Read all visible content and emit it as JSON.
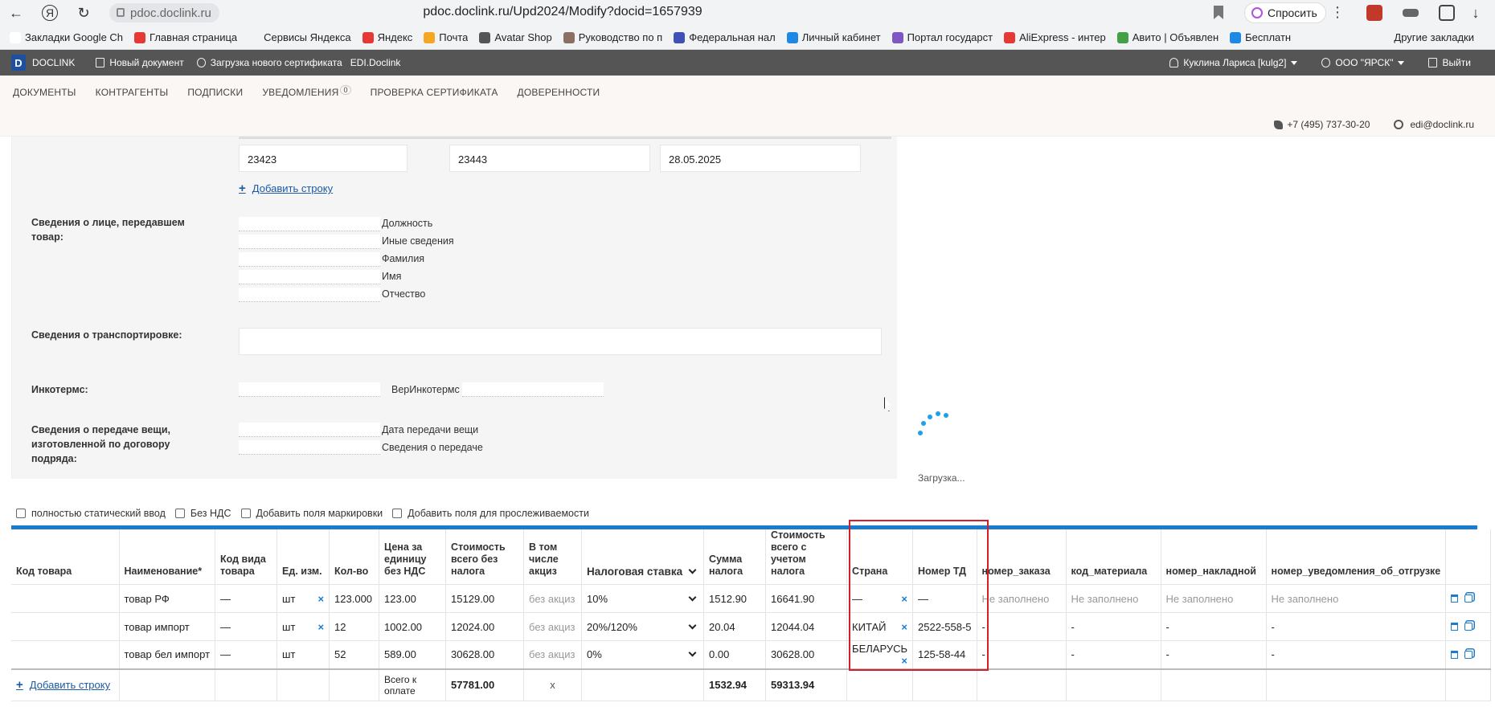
{
  "browser": {
    "host": "pdoc.doclink.ru",
    "url": "pdoc.doclink.ru/Upd2024/Modify?docid=1657939",
    "ask_label": "Спросить",
    "bookmarks": [
      {
        "label": "Закладки Google Ch",
        "color": "#ffffff"
      },
      {
        "label": "Главная страница",
        "color": "#e53935"
      },
      {
        "label": "Сервисы Яндекса",
        "color": "#f1f3f4"
      },
      {
        "label": "Яндекс",
        "color": "#e53935"
      },
      {
        "label": "Почта",
        "color": "#f5a623"
      },
      {
        "label": "Avatar Shop",
        "color": "#555555"
      },
      {
        "label": "Руководство по п",
        "color": "#8d6e63"
      },
      {
        "label": "Федеральная нал",
        "color": "#3f51b5"
      },
      {
        "label": "Личный кабинет",
        "color": "#1e88e5"
      },
      {
        "label": "Портал государст",
        "color": "#7e57c2"
      },
      {
        "label": "AliExpress - интер",
        "color": "#e53935"
      },
      {
        "label": "Авито | Объявлен",
        "color": "#43a047"
      },
      {
        "label": "Бесплатн",
        "color": "#1e88e5"
      }
    ],
    "other_bookmarks": "Другие закладки"
  },
  "app": {
    "logo": "D",
    "brand": "DOCLINK",
    "new_doc": "Новый документ",
    "upload_cert": "Загрузка нового сертификата",
    "edi": "EDI.Doclink",
    "user": "Куклина Лариса [kulg2]",
    "org": "ООО \"ЯРСК\"",
    "logout": "Выйти"
  },
  "nav": {
    "documents": "ДОКУМЕНТЫ",
    "contractors": "КОНТРАГЕНТЫ",
    "signatures": "ПОДПИСКИ",
    "notifications": "УВЕДОМЛЕНИЯ",
    "notifications_count": "0",
    "cert_check": "ПРОВЕРКА СЕРТИФИКАТА",
    "powers": "ДОВЕРЕННОСТИ",
    "phone": "+7 (495) 737-30-20",
    "email": "edi@doclink.ru"
  },
  "form": {
    "top_row": [
      "23423",
      "23443",
      "28.05.2025"
    ],
    "add_row": "Добавить строку",
    "transferor_label": "Сведения о лице, передавшем товар:",
    "transferor_fields": [
      "Должность",
      "Иные сведения",
      "Фамилия",
      "Имя",
      "Отчество"
    ],
    "transport_label": "Сведения о транспортировке:",
    "incoterms_label": "Инкотермс:",
    "ver_incoterms": "ВерИнкотермс",
    "thing_label": "Сведения о передаче вещи, изготовленной по договору подряда:",
    "thing_fields": [
      "Дата передачи вещи",
      "Сведения о передаче"
    ]
  },
  "loader_text": "Загрузка...",
  "options": [
    "полностью статический ввод",
    "Без НДС",
    "Добавить поля маркировки",
    "Добавить поля для прослеживаемости"
  ],
  "table": {
    "headers": [
      "Код товара",
      "Наименование*",
      "Код вида товара",
      "Ед. изм.",
      "Кол-во",
      "Цена за единицу без НДС",
      "Стоимость всего без налога",
      "В том числе акциз",
      "Налоговая ставка",
      "Сумма налога",
      "Стоимость всего с учетом налога",
      "Страна",
      "Номер ТД",
      "номер_заказа",
      "код_материала",
      "номер_накладной",
      "номер_уведомления_об_отгрузке"
    ],
    "rows": [
      {
        "code": "",
        "name": "товар РФ",
        "kind": "—",
        "unit": "шт",
        "unit_x": true,
        "qty": "123.000",
        "price": "123.00",
        "total": "15129.00",
        "excise": "без акциз",
        "rate": "10%",
        "tax": "1512.90",
        "total_tax": "16641.90",
        "country": "—",
        "country_x": true,
        "td": "—",
        "order": "Не заполнено",
        "material": "Не заполнено",
        "waybill": "Не заполнено",
        "notice": "Не заполнено"
      },
      {
        "code": "",
        "name": "товар импорт",
        "kind": "—",
        "unit": "шт",
        "unit_x": true,
        "qty": "12",
        "price": "1002.00",
        "total": "12024.00",
        "excise": "без акциз",
        "rate": "20%/120%",
        "tax": "20.04",
        "total_tax": "12044.04",
        "country": "КИТАЙ",
        "country_x": true,
        "td": "2522-558-5",
        "order": "-",
        "material": "-",
        "waybill": "-",
        "notice": "-"
      },
      {
        "code": "",
        "name": "товар бел импорт",
        "kind": "—",
        "unit": "шт",
        "unit_x": false,
        "qty": "52",
        "price": "589.00",
        "total": "30628.00",
        "excise": "без акциз",
        "rate": "0%",
        "tax": "0.00",
        "total_tax": "30628.00",
        "country": "БЕЛАРУСЬ",
        "country_x": true,
        "td": "125-58-44",
        "order": "-",
        "material": "-",
        "waybill": "-",
        "notice": "-"
      }
    ],
    "footer": {
      "add_row": "Добавить строку",
      "total_label": "Всего к оплате",
      "total": "57781.00",
      "excise": "x",
      "tax": "1532.94",
      "total_tax": "59313.94"
    }
  }
}
